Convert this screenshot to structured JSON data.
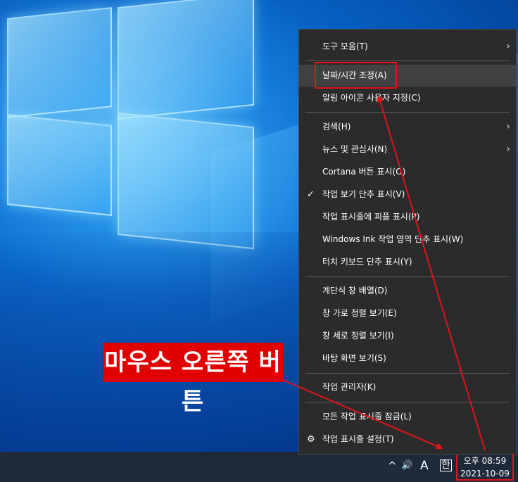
{
  "callout_text": "마우스 오른쪽 버튼",
  "menu": {
    "items": [
      {
        "label": "도구 모음(T)",
        "submenu": true
      },
      {
        "label": "날짜/시간 조정(A)",
        "highlighted": true
      },
      {
        "label": "알림 아이콘 사용자 지정(C)"
      },
      {
        "label": "검색(H)",
        "submenu": true
      },
      {
        "label": "뉴스 및 관심사(N)",
        "submenu": true
      },
      {
        "label": "Cortana 버튼 표시(O)"
      },
      {
        "label": "작업 보기 단추 표시(V)",
        "checked": true
      },
      {
        "label": "작업 표시줄에 피플 표시(P)"
      },
      {
        "label": "Windows Ink 작업 영역 단추 표시(W)"
      },
      {
        "label": "터치 키보드 단추 표시(Y)"
      },
      {
        "label": "계단식 창 배열(D)"
      },
      {
        "label": "창 가로 정렬 보기(E)"
      },
      {
        "label": "창 세로 정렬 보기(I)"
      },
      {
        "label": "바탕 화면 보기(S)"
      },
      {
        "label": "작업 관리자(K)"
      },
      {
        "label": "모든 작업 표시줄 잠금(L)"
      },
      {
        "label": "작업 표시줄 설정(T)",
        "icon": "gear-icon"
      }
    ]
  },
  "tray": {
    "chevron_icon": "^",
    "volume_icon": "🔊",
    "ime_text": "A",
    "lang_text": "한",
    "time": "오후 08:59",
    "date": "2021-10-09"
  },
  "colors": {
    "accent_red": "#e0141a",
    "menu_bg": "#2b2b2b",
    "taskbar_bg": "#1e2a3a"
  }
}
